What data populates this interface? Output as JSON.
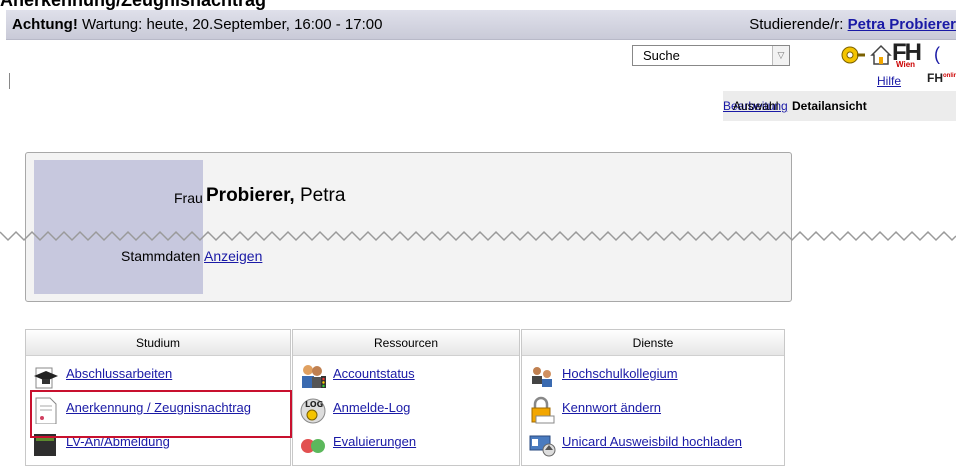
{
  "page_title": "Anerkennung/Zeugnisnachtrag",
  "maintenance": {
    "prefix": "Achtung!",
    "text": " Wartung: heute, 20.September, 16:00 - 17:00"
  },
  "user": {
    "label": "Studierende/r: ",
    "name": "Petra Probierer"
  },
  "search": {
    "value": "Suche",
    "dropdown_glyph": "▽"
  },
  "logo": {
    "fh_text": "FH",
    "fh_sub": "Wien",
    "small_text": "FH",
    "small_sup": "online"
  },
  "help_label": "Hilfe",
  "view_tabs": {
    "auswahl": "Auswahl",
    "detail": "Detailansicht",
    "bearbeitung": "Bearbeitung"
  },
  "person": {
    "salutation": "Frau",
    "last_name": "Probierer,",
    "first_name": " Petra",
    "stammdaten_label": "Stammdaten",
    "stammdaten_link": "Anzeigen"
  },
  "panels": [
    {
      "title": "Studium",
      "items": [
        {
          "label": "Abschlussarbeiten",
          "icon": "graduation-cap-icon"
        },
        {
          "label": "Anerkennung / Zeugnisnachtrag",
          "icon": "document-icon"
        },
        {
          "label": "LV-An/Abmeldung",
          "icon": "course-registration-icon"
        }
      ]
    },
    {
      "title": "Ressourcen",
      "items": [
        {
          "label": "Accountstatus",
          "icon": "users-status-icon"
        },
        {
          "label": "Anmelde-Log",
          "icon": "login-log-icon"
        },
        {
          "label": "Evaluierungen",
          "icon": "smiley-rating-icon"
        }
      ]
    },
    {
      "title": "Dienste",
      "items": [
        {
          "label": "Hochschulkollegium",
          "icon": "council-icon"
        },
        {
          "label": "Kennwort ändern",
          "icon": "lock-password-icon"
        },
        {
          "label": "Unicard Ausweisbild hochladen",
          "icon": "id-card-upload-icon"
        }
      ]
    }
  ],
  "colors": {
    "link": "#1a1aa6",
    "highlight": "#c8102e",
    "photo_placeholder": "#c7c8de"
  }
}
